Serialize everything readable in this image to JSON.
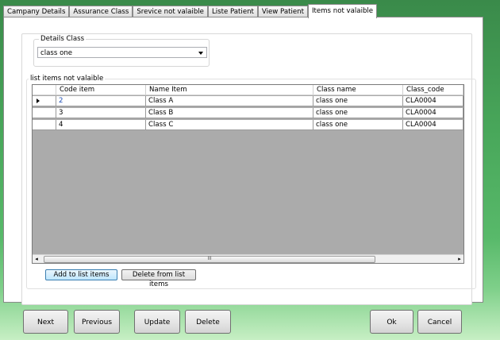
{
  "tabs": [
    {
      "label": "Campany Details"
    },
    {
      "label": "Assurance Class"
    },
    {
      "label": "Srevice not valaible"
    },
    {
      "label": "Liste Patient"
    },
    {
      "label": "View Patient"
    },
    {
      "label": "Items not valaible"
    }
  ],
  "details_class": {
    "legend": "Details Class",
    "selected": "class one"
  },
  "list_group": {
    "legend": "list items not valaible"
  },
  "table": {
    "columns": [
      "Code item",
      "Name Item",
      "Class name",
      "Class_code"
    ],
    "rows": [
      [
        "2",
        "Class A",
        "class one",
        "CLA0004"
      ],
      [
        "3",
        "Class B",
        "class one",
        "CLA0004"
      ],
      [
        "4",
        "Class C",
        "class one",
        "CLA0004"
      ]
    ],
    "scroll_grip": "III"
  },
  "actions": {
    "add": "Add to list items",
    "delete": "Delete from list items"
  },
  "footer": {
    "next": "Next",
    "previous": "Previous",
    "update": "Update",
    "delete": "Delete",
    "ok": "Ok",
    "cancel": "Cancel"
  },
  "colors": {
    "selected_text": "#1f4fb5",
    "grid_empty": "#ababab"
  }
}
